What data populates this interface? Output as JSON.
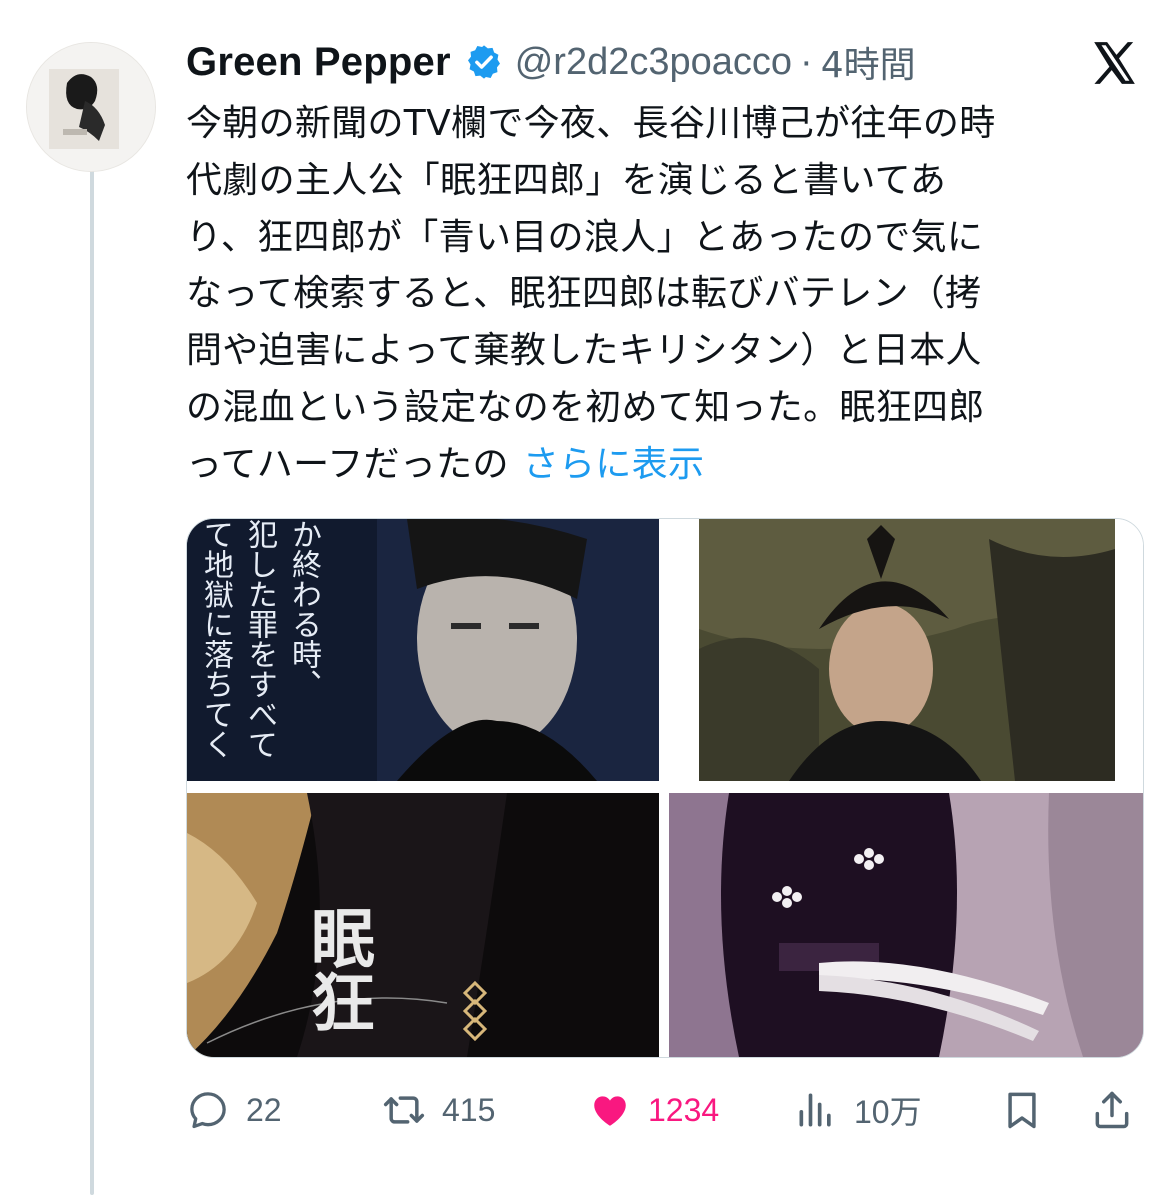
{
  "author": {
    "display_name": "Green Pepper",
    "handle": "@r2d2c3poacco",
    "separator": "·",
    "time_ago": "4時間"
  },
  "tweet": {
    "lines": [
      "今朝の新聞のTV欄で今夜、長谷川博己が往年の時",
      "代劇の主人公「眠狂四郎」を演じると書いてあ",
      "り、狂四郎が「青い目の浪人」とあったので気に",
      "なって検索すると、眠狂四郎は転びバテレン（拷",
      "問や迫害によって棄教したキリシタン）と日本人",
      "の混血という設定なのを初めて知った。眠狂四郎",
      "ってハーフだったの"
    ],
    "show_more": "さらに表示"
  },
  "media": {
    "image1_caption_chars": [
      "か終わる時、",
      "犯した罪をすべて",
      "て地獄に落ちてく"
    ],
    "image3_caption_chars": "眠狂"
  },
  "actions": {
    "replies": "22",
    "retweets": "415",
    "likes": "1234",
    "views": "10万"
  },
  "colors": {
    "accent": "#1d9bf0",
    "like": "#f91880",
    "muted": "#536471",
    "text": "#0f1419"
  },
  "icons": [
    "verified-badge-icon",
    "x-logo-icon",
    "reply-icon",
    "retweet-icon",
    "heart-icon",
    "views-icon",
    "bookmark-icon",
    "share-icon"
  ]
}
